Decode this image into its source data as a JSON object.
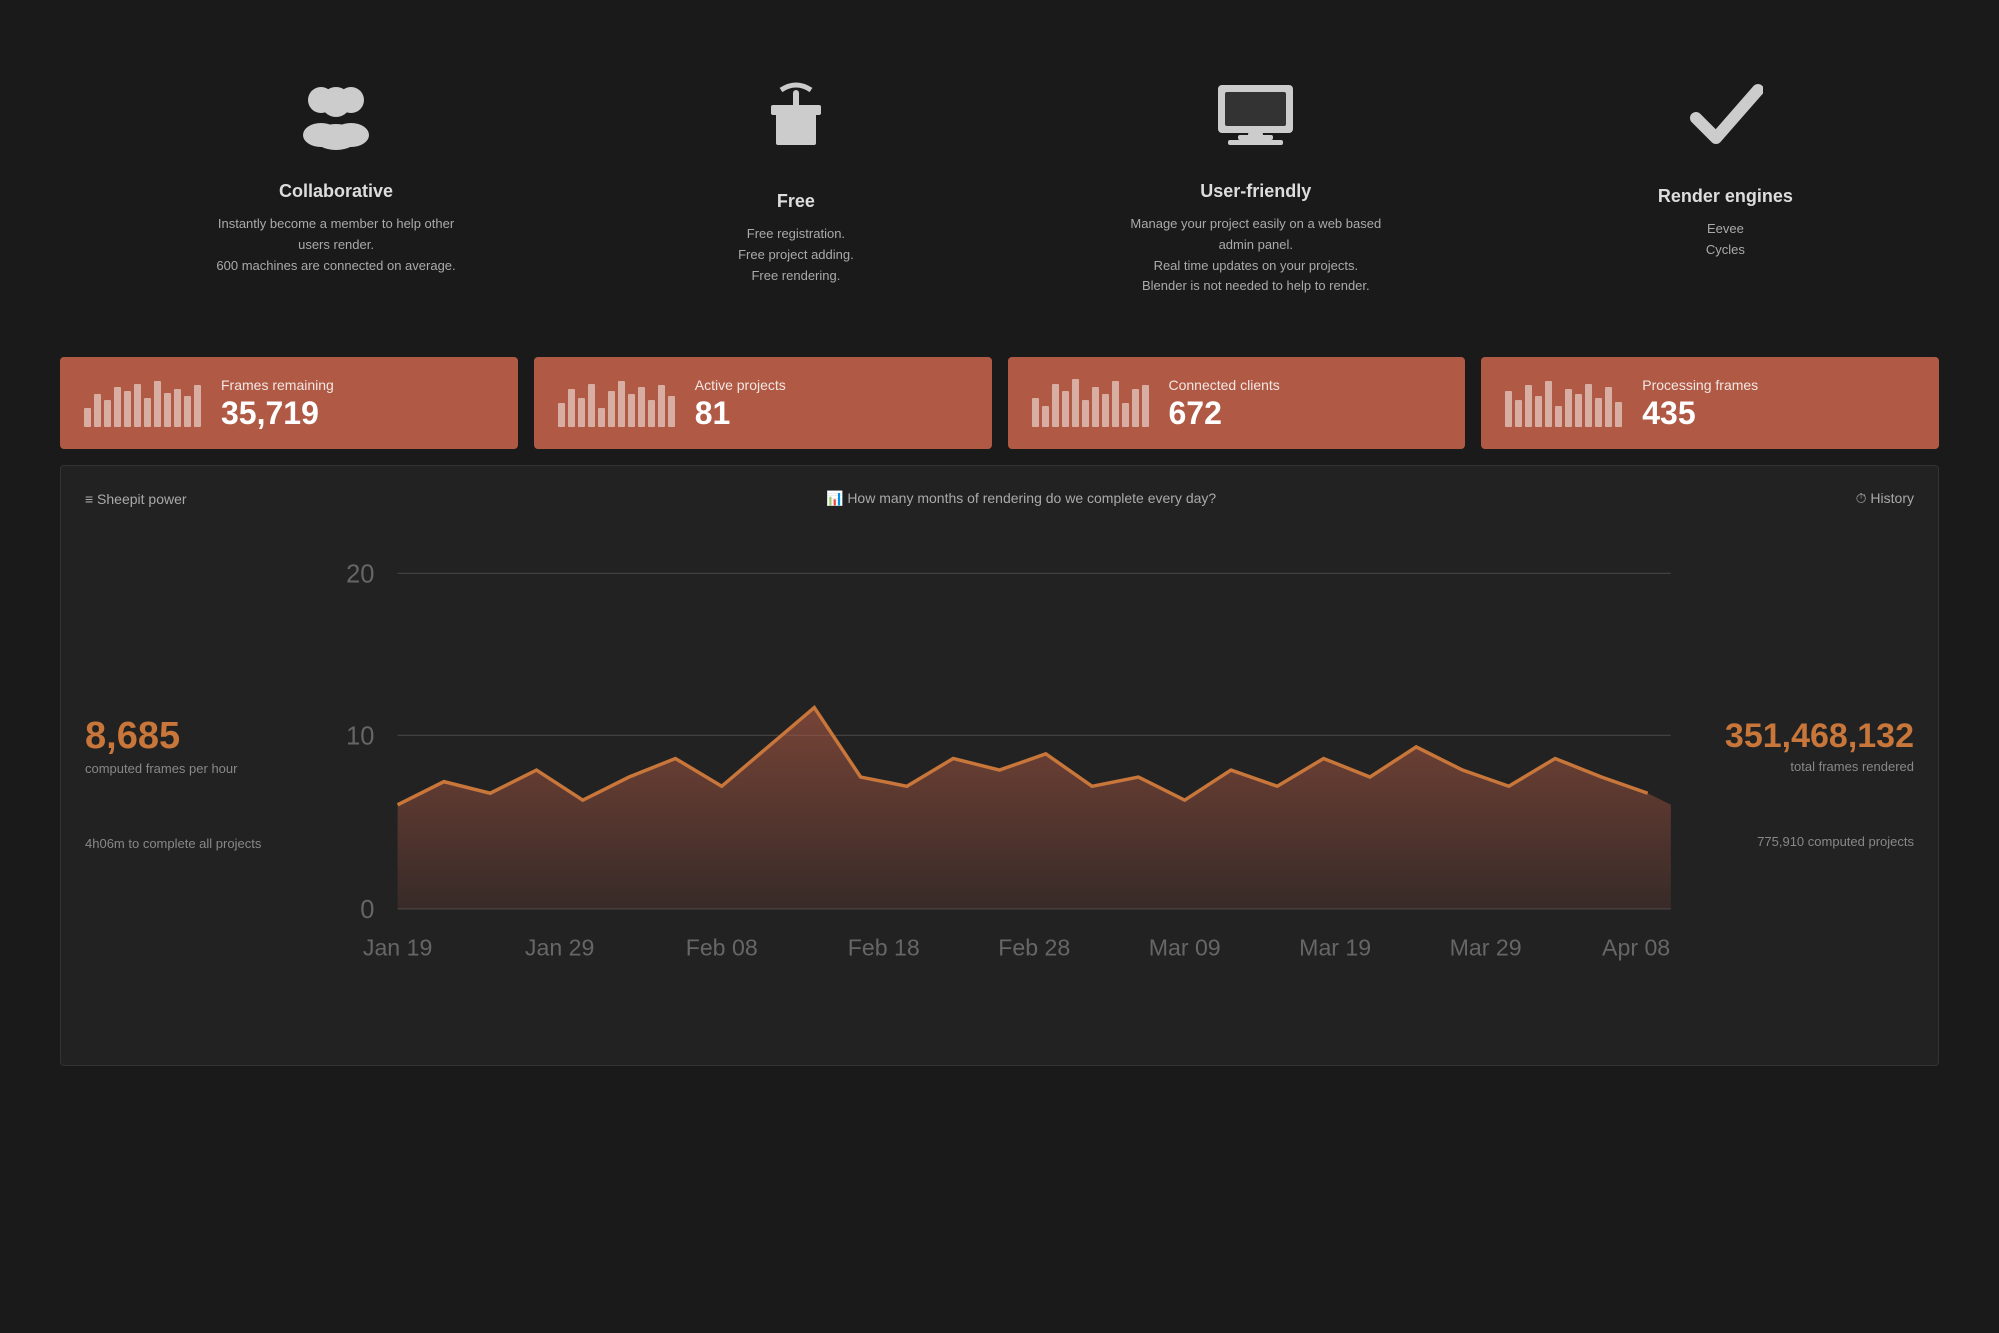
{
  "features": [
    {
      "id": "collaborative",
      "icon": "👥",
      "title": "Collaborative",
      "desc": "Instantly become a member to help other users render.\n600 machines are connected on average."
    },
    {
      "id": "free",
      "icon": "🎁",
      "title": "Free",
      "desc": "Free registration.\nFree project adding.\nFree rendering."
    },
    {
      "id": "user-friendly",
      "icon": "💻",
      "title": "User-friendly",
      "desc": "Manage your project easily on a web based admin panel.\nReal time updates on your projects.\nBlender is not needed to help to render."
    },
    {
      "id": "render-engines",
      "icon": "✔",
      "title": "Render engines",
      "desc": "Eevee\nCycles"
    }
  ],
  "stats": [
    {
      "id": "frames-remaining",
      "label": "Frames remaining",
      "value": "35,719",
      "bars": [
        20,
        35,
        28,
        42,
        38,
        45,
        30,
        48,
        36,
        40,
        32,
        44
      ]
    },
    {
      "id": "active-projects",
      "label": "Active projects",
      "value": "81",
      "bars": [
        25,
        40,
        30,
        45,
        20,
        38,
        48,
        35,
        42,
        28,
        44,
        32
      ]
    },
    {
      "id": "connected-clients",
      "label": "Connected clients",
      "value": "672",
      "bars": [
        30,
        22,
        45,
        38,
        50,
        28,
        42,
        35,
        48,
        25,
        40,
        44
      ]
    },
    {
      "id": "processing-frames",
      "label": "Processing frames",
      "value": "435",
      "bars": [
        38,
        28,
        44,
        32,
        48,
        22,
        40,
        35,
        45,
        30,
        42,
        26
      ]
    }
  ],
  "dashboard": {
    "left_section_title": "≡ Sheepit power",
    "center_section_title": "📊 How many months of rendering do we complete every day?",
    "right_section_title": "⏱ History",
    "main_stat": "8,685",
    "main_stat_label": "computed frames per hour",
    "total_stat": "351,468,132",
    "total_stat_label": "total frames rendered",
    "footer_left": "4h06m to complete all projects",
    "footer_right": "775,910 computed projects",
    "chart": {
      "y_labels": [
        "20",
        "10",
        "0"
      ],
      "x_labels": [
        "Jan 19",
        "Jan 29",
        "Feb 08",
        "Feb 18",
        "Feb 28",
        "Mar 09",
        "Mar 19",
        "Mar 29",
        "Apr 08"
      ]
    }
  }
}
